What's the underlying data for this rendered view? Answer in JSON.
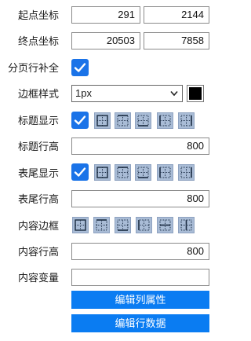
{
  "start": {
    "label": "起点坐标",
    "x": "291",
    "y": "2144"
  },
  "end": {
    "label": "终点坐标",
    "x": "20503",
    "y": "7858"
  },
  "paging": {
    "label": "分页行补全",
    "checked": true
  },
  "border_style": {
    "label": "边框样式",
    "value": "1px",
    "color": "#000000"
  },
  "title_show": {
    "label": "标题显示",
    "checked": true
  },
  "title_row_height": {
    "label": "标题行高",
    "value": "800"
  },
  "footer_show": {
    "label": "表尾显示",
    "checked": true
  },
  "footer_row_height": {
    "label": "表尾行高",
    "value": "800"
  },
  "content_border": {
    "label": "内容边框"
  },
  "content_row_height": {
    "label": "内容行高",
    "value": "800"
  },
  "content_variable": {
    "label": "内容变量",
    "value": ""
  },
  "buttons": {
    "edit_columns": "编辑列属性",
    "edit_rows": "编辑行数据"
  },
  "colors": {
    "accent": "#0a7cf2",
    "checkbox": "#1a73e8",
    "border_icon_bg": "#a9bcd6"
  }
}
